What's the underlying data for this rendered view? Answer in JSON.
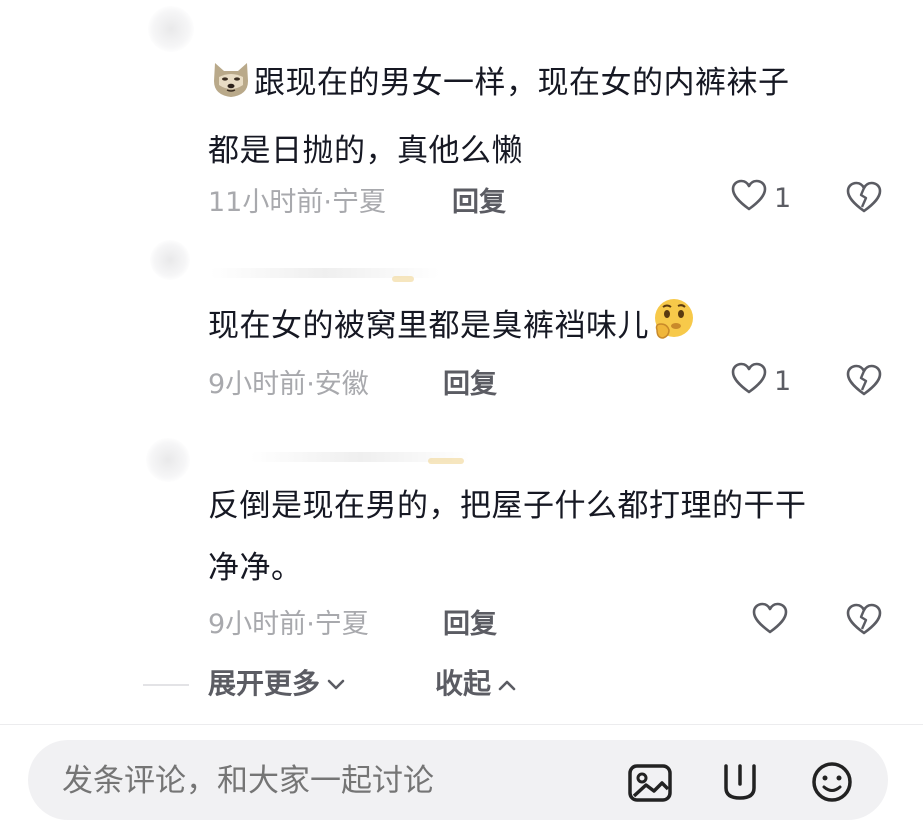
{
  "comments": [
    {
      "text_lines": [
        "跟现在的男女一样，现在女的内裤袜子",
        "都是日抛的，真他么懒"
      ],
      "time": "11小时前",
      "location": "宁夏",
      "reply_label": "回复",
      "likes": "1",
      "lead_emoji": "dog-face-emoji"
    },
    {
      "text": "现在女的被窝里都是臭裤裆味儿",
      "time": "9小时前",
      "location": "安徽",
      "reply_label": "回复",
      "likes": "1",
      "trail_emoji": "thinking-face-emoji"
    },
    {
      "text_lines": [
        "反倒是现在男的，把屋子什么都打理的干干",
        "净净。"
      ],
      "time": "9小时前",
      "location": "宁夏",
      "reply_label": "回复",
      "likes": ""
    }
  ],
  "meta_separator": "·",
  "expand_label": "展开更多",
  "collapse_label": "收起",
  "input": {
    "placeholder": "发条评论，和大家一起讨论"
  },
  "colors": {
    "text": "#161823",
    "meta": "#a8a9ad",
    "action": "#5b5c63",
    "input_bg": "#f1f1f3"
  }
}
